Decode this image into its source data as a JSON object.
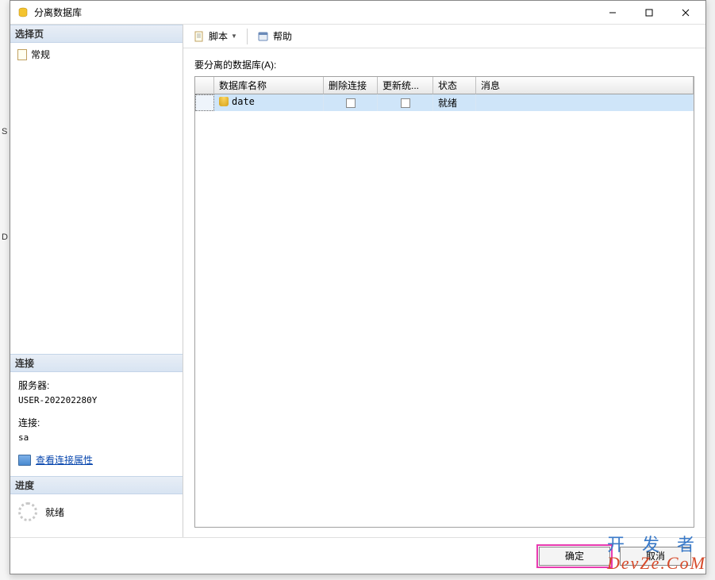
{
  "window": {
    "title": "分离数据库"
  },
  "left": {
    "select_page_header": "选择页",
    "general_page": "常规",
    "connection_header": "连接",
    "server_label": "服务器:",
    "server_value": "USER-202202280Y",
    "conn_label": "连接:",
    "conn_value": "sa",
    "view_props": "查看连接属性",
    "progress_header": "进度",
    "progress_status": "就绪"
  },
  "toolbar": {
    "script_label": "脚本",
    "help_label": "帮助"
  },
  "main": {
    "list_label": "要分离的数据库(A):",
    "columns": {
      "name": "数据库名称",
      "drop": "删除连接",
      "update": "更新统...",
      "status": "状态",
      "message": "消息"
    },
    "rows": [
      {
        "name": "date",
        "drop": false,
        "update": false,
        "status": "就绪",
        "message": ""
      }
    ]
  },
  "buttons": {
    "ok": "确定",
    "cancel": "取消"
  },
  "watermark": {
    "cn": "开发者",
    "en": "DevZe.CoM"
  }
}
